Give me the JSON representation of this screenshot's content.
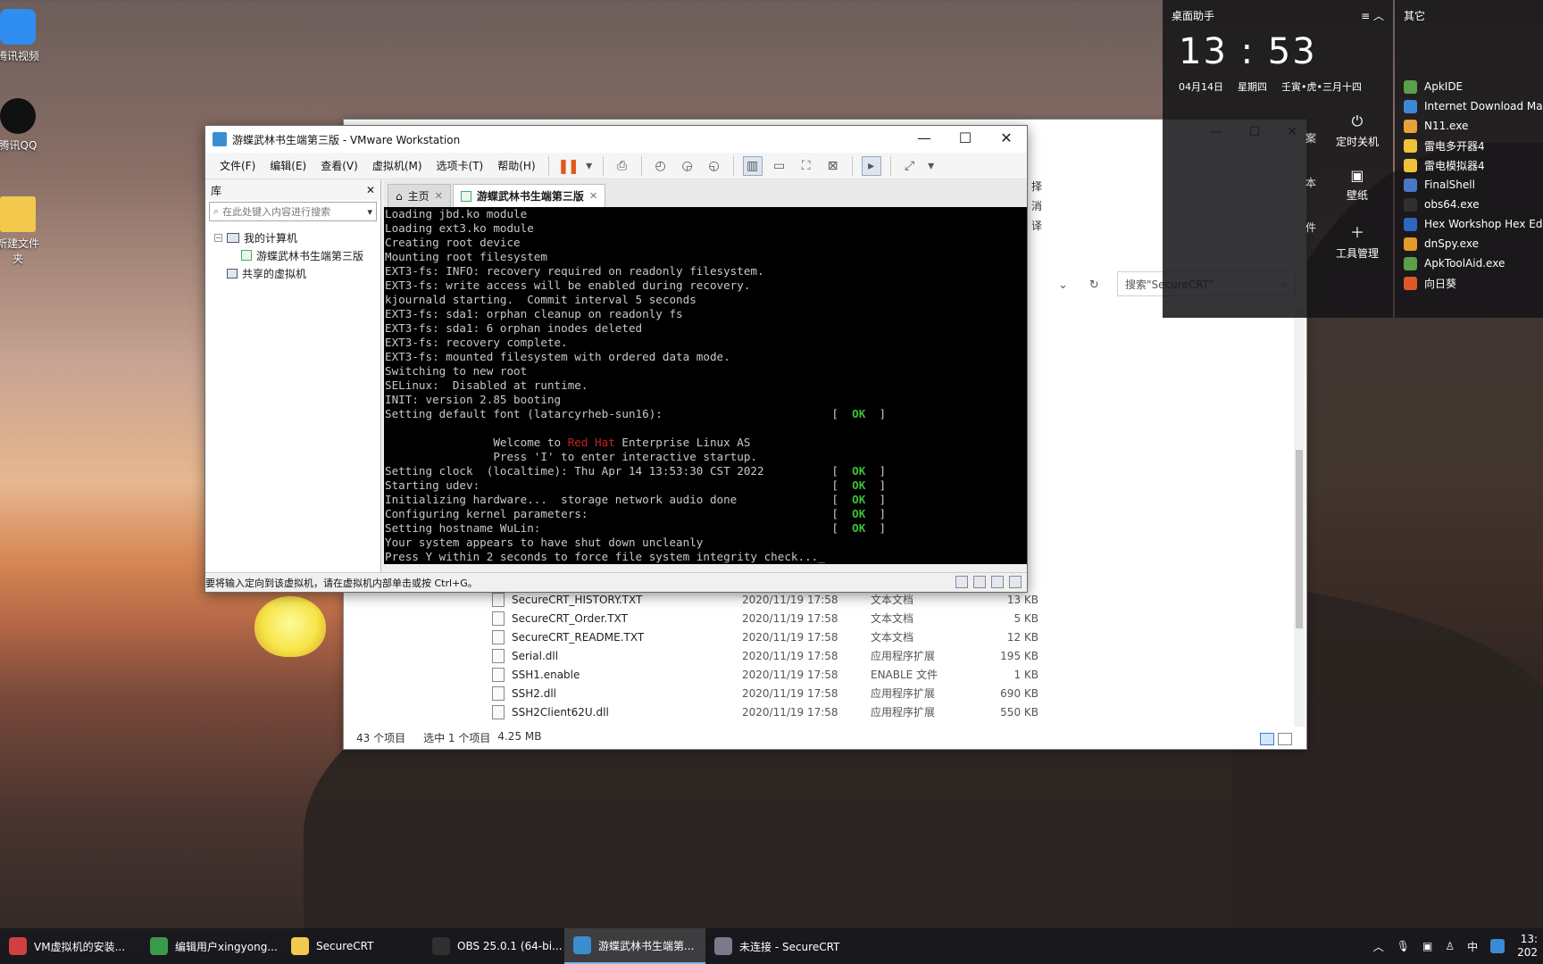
{
  "desktop": {
    "icons": [
      {
        "label": "腾讯视频",
        "color": "#2f8ef0"
      },
      {
        "label": "腾讯QQ",
        "color": "#111111"
      },
      {
        "label": "新建文件夹",
        "color": "#f2c94c"
      }
    ]
  },
  "explorer": {
    "search_placeholder": "搜索\"SecureCRT\"",
    "side_texts": [
      "择",
      "消",
      "译"
    ],
    "files": [
      {
        "name": "SecureCRT_HISTORY.TXT",
        "date": "2020/11/19 17:58",
        "type": "文本文档",
        "size": "13 KB"
      },
      {
        "name": "SecureCRT_Order.TXT",
        "date": "2020/11/19 17:58",
        "type": "文本文档",
        "size": "5 KB"
      },
      {
        "name": "SecureCRT_README.TXT",
        "date": "2020/11/19 17:58",
        "type": "文本文档",
        "size": "12 KB"
      },
      {
        "name": "Serial.dll",
        "date": "2020/11/19 17:58",
        "type": "应用程序扩展",
        "size": "195 KB"
      },
      {
        "name": "SSH1.enable",
        "date": "2020/11/19 17:58",
        "type": "ENABLE 文件",
        "size": "1 KB"
      },
      {
        "name": "SSH2.dll",
        "date": "2020/11/19 17:58",
        "type": "应用程序扩展",
        "size": "690 KB"
      },
      {
        "name": "SSH2Client62U.dll",
        "date": "2020/11/19 17:58",
        "type": "应用程序扩展",
        "size": "550 KB"
      }
    ],
    "status": {
      "count": "43 个项目",
      "selected": "选中 1 个项目",
      "size": "4.25 MB"
    }
  },
  "vmware": {
    "title": "游蝶武林书生端第三版 - VMware Workstation",
    "menu": [
      "文件(F)",
      "编辑(E)",
      "查看(V)",
      "虚拟机(M)",
      "选项卡(T)",
      "帮助(H)"
    ],
    "library": {
      "title": "库",
      "search_placeholder": "在此处键入内容进行搜索",
      "my_computer": "我的计算机",
      "vm_name": "游蝶武林书生端第三版",
      "shared": "共享的虚拟机"
    },
    "tabs": {
      "home": "主页",
      "vm": "游蝶武林书生端第三版"
    },
    "console": {
      "pre_lines": [
        "Loading jbd.ko module",
        "Loading ext3.ko module",
        "Creating root device",
        "Mounting root filesystem",
        "EXT3-fs: INFO: recovery required on readonly filesystem.",
        "EXT3-fs: write access will be enabled during recovery.",
        "kjournald starting.  Commit interval 5 seconds",
        "EXT3-fs: sda1: orphan cleanup on readonly fs",
        "EXT3-fs: sda1: 6 orphan inodes deleted",
        "EXT3-fs: recovery complete.",
        "EXT3-fs: mounted filesystem with ordered data mode.",
        "Switching to new root",
        "SELinux:  Disabled at runtime.",
        "INIT: version 2.85 booting"
      ],
      "font_line": "Setting default font (latarcyrheb-sun16):",
      "ok": "OK",
      "welcome_prefix": "Welcome to ",
      "welcome_brand": "Red Hat",
      "welcome_suffix": " Enterprise Linux AS",
      "press_i": "Press 'I' to enter interactive startup.",
      "ok_lines": [
        "Setting clock  (localtime): Thu Apr 14 13:53:30 CST 2022",
        "Starting udev:",
        "Initializing hardware...  storage network audio done",
        "Configuring kernel parameters:",
        "Setting hostname WuLin:"
      ],
      "tail_lines": [
        "Your system appears to have shut down uncleanly",
        "Press Y within 2 seconds to force file system integrity check..._"
      ]
    },
    "statusbar": "要将输入定向到该虚拟机，请在虚拟机内部单击或按 Ctrl+G。"
  },
  "assistant": {
    "title": "桌面助手",
    "time": "13 : 53",
    "date": "04月14日",
    "weekday": "星期四",
    "lunar": "壬寅•虎•三月十四",
    "tools": [
      "定时关机",
      "壁纸",
      "工具管理"
    ],
    "side_texts": [
      "案",
      "本",
      "件"
    ]
  },
  "other": {
    "title": "其它",
    "apps": [
      {
        "name": "ApkIDE",
        "color": "#5aa04a"
      },
      {
        "name": "Internet Download Ma",
        "color": "#3b8ad8"
      },
      {
        "name": "N11.exe",
        "color": "#e8a23a"
      },
      {
        "name": "雷电多开器4",
        "color": "#f0c23a"
      },
      {
        "name": "雷电模拟器4",
        "color": "#f0c23a"
      },
      {
        "name": "FinalShell",
        "color": "#4a78c8"
      },
      {
        "name": "obs64.exe",
        "color": "#303030"
      },
      {
        "name": "Hex Workshop Hex Ed",
        "color": "#2f66c0"
      },
      {
        "name": "dnSpy.exe",
        "color": "#e39a2a"
      },
      {
        "name": "ApkToolAid.exe",
        "color": "#5aa04a"
      },
      {
        "name": "向日葵",
        "color": "#e0582a"
      }
    ]
  },
  "taskbar": {
    "tasks": [
      {
        "label": "VM虚拟机的安装...",
        "color": "#d04040"
      },
      {
        "label": "编辑用户xingyong...",
        "color": "#3a9a4a"
      },
      {
        "label": "SecureCRT",
        "color": "#f2c94c"
      },
      {
        "label": "OBS 25.0.1 (64-bi...",
        "color": "#303030"
      },
      {
        "label": "游蝶武林书生端第...",
        "color": "#3a8ed0"
      },
      {
        "label": "未连接 - SecureCRT",
        "color": "#7a7a8a"
      }
    ],
    "tray": {
      "time": "13:",
      "year": "202",
      "ime": "中"
    }
  }
}
